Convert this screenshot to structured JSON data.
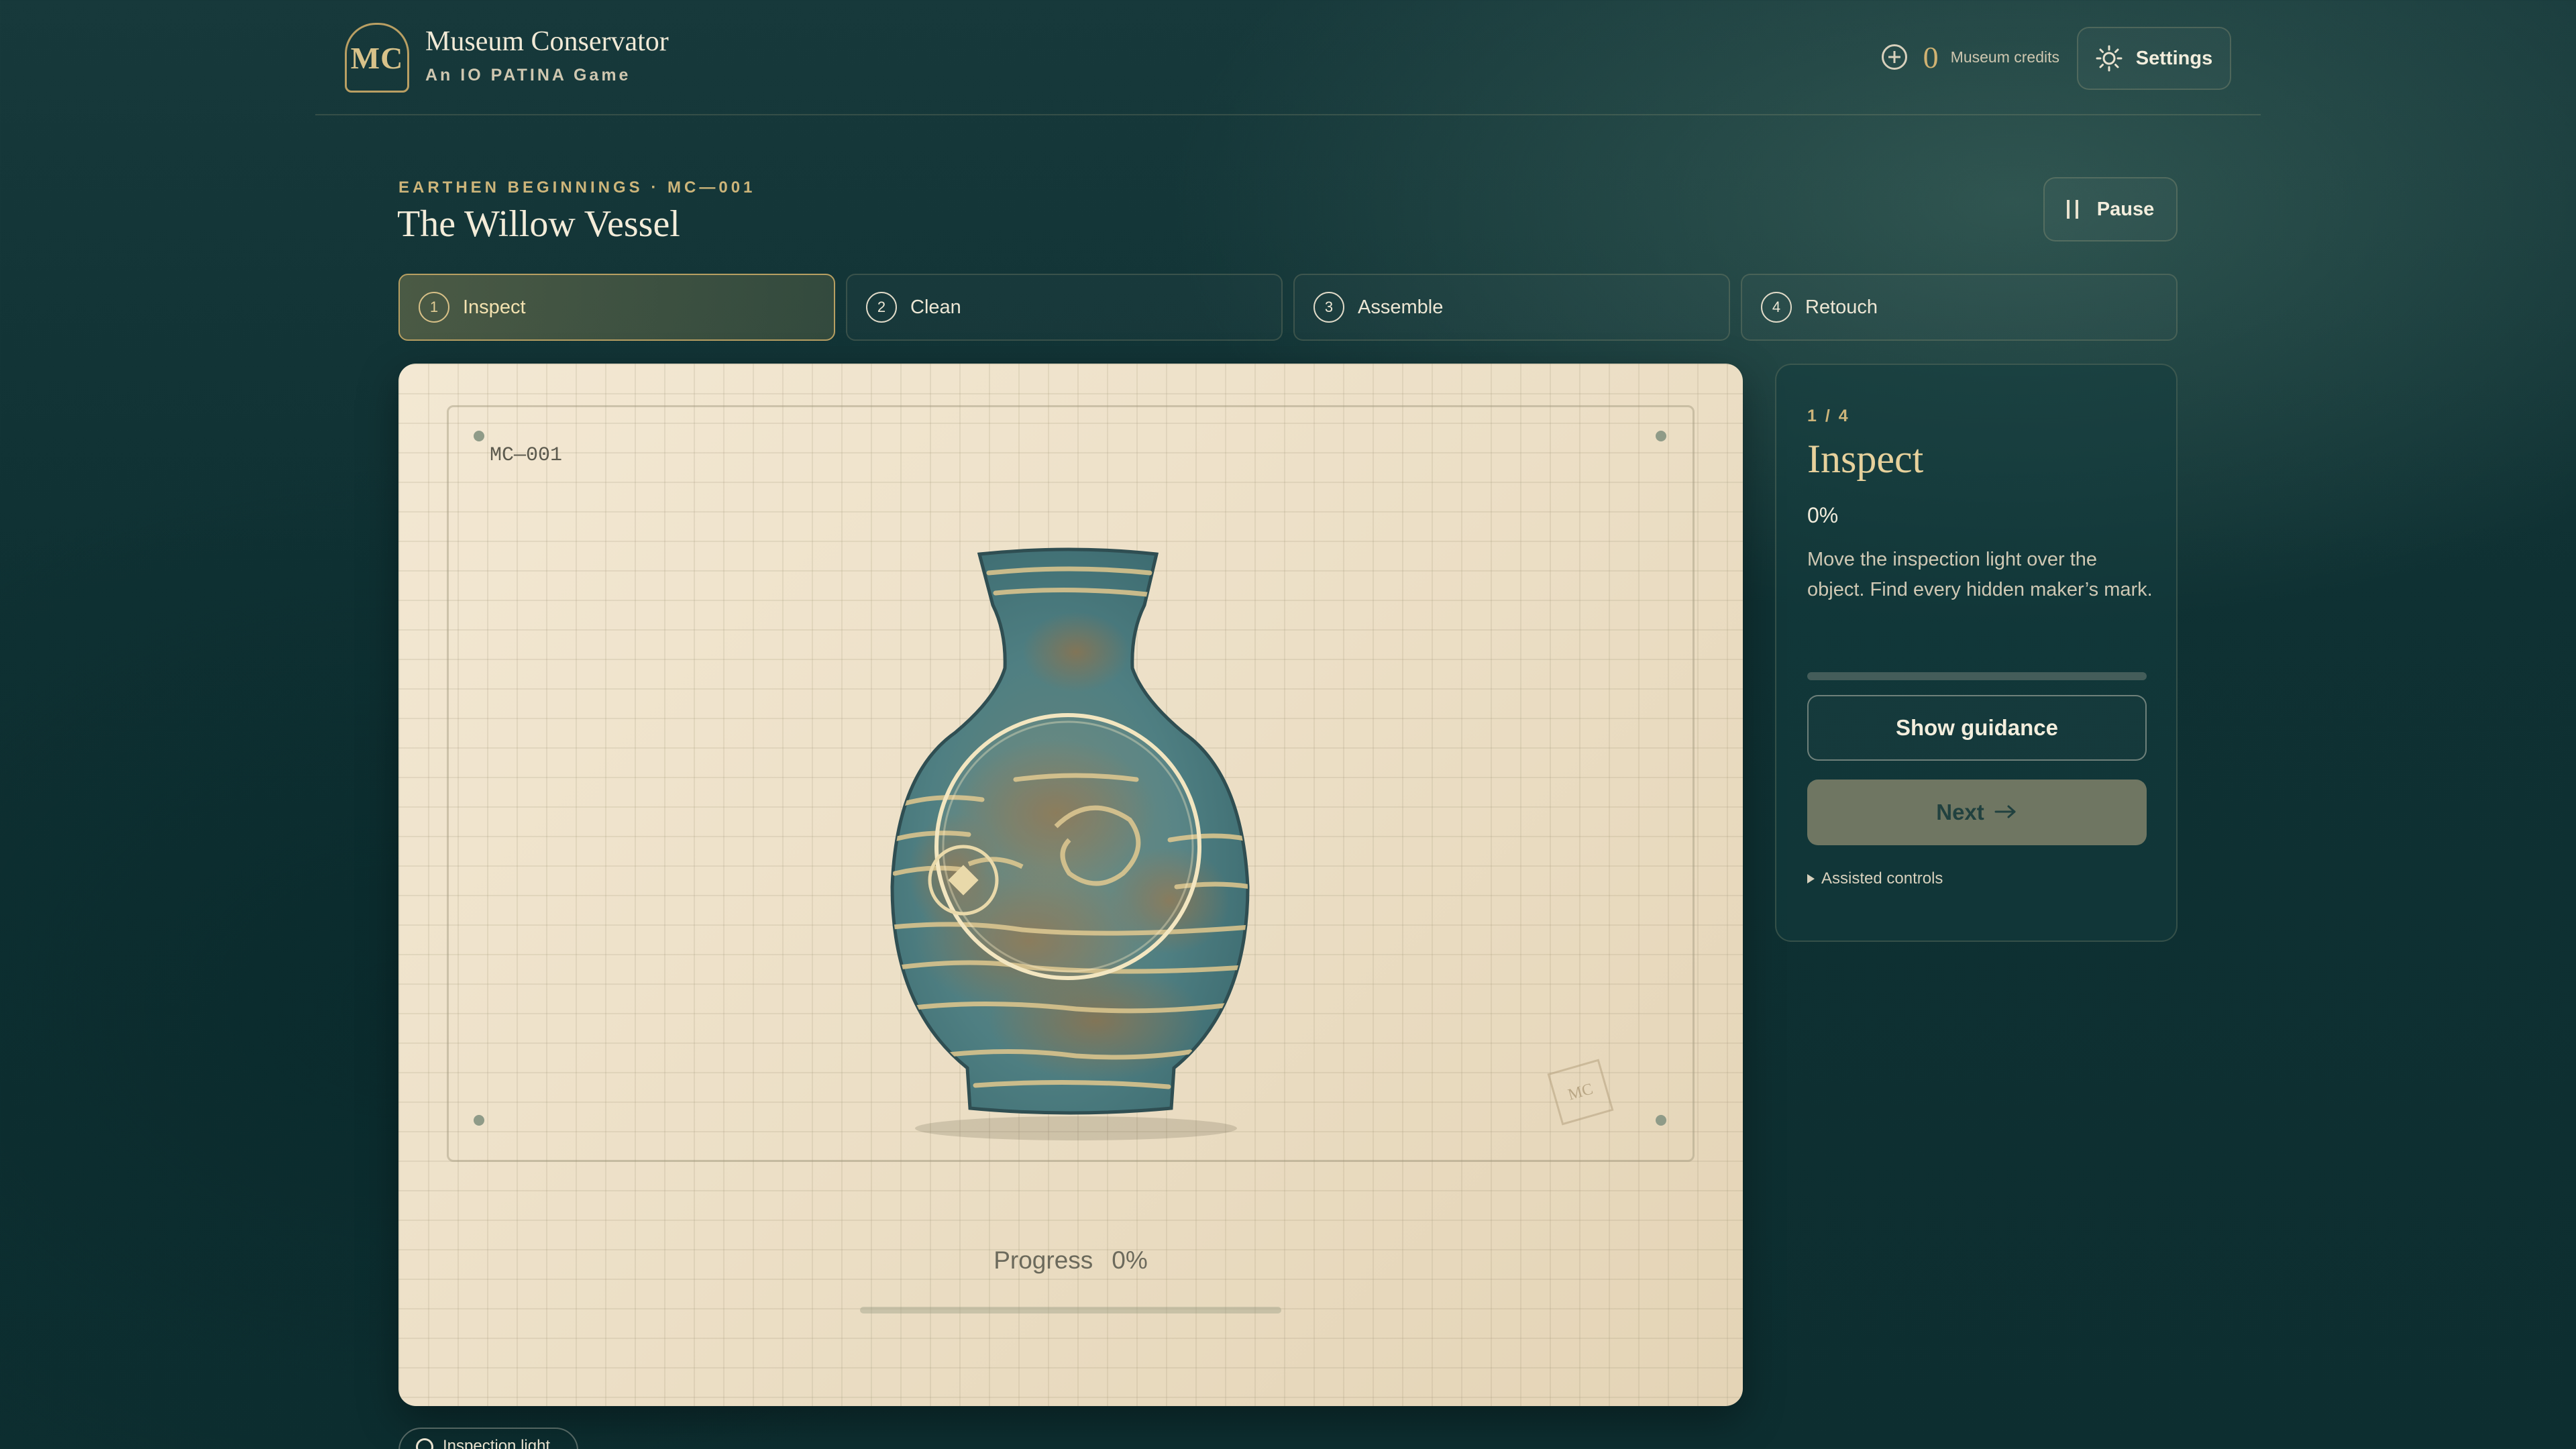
{
  "header": {
    "logo_text": "MC",
    "title": "Museum Conservator",
    "subtitle": "An IO PATINA Game",
    "credits_count": "0",
    "credits_label": "Museum credits",
    "settings_label": "Settings"
  },
  "level": {
    "eyebrow": "EARTHEN BEGINNINGS · MC—001",
    "title": "The Willow Vessel",
    "pause_label": "Pause"
  },
  "steps": [
    {
      "num": "1",
      "label": "Inspect"
    },
    {
      "num": "2",
      "label": "Clean"
    },
    {
      "num": "3",
      "label": "Assemble"
    },
    {
      "num": "4",
      "label": "Retouch"
    }
  ],
  "canvas": {
    "catalog_code": "MC—001",
    "stamp_text": "MC",
    "progress_label": "Progress",
    "progress_value": "0%",
    "progress_fraction": 0
  },
  "panel": {
    "step_count": "1 / 4",
    "title": "Inspect",
    "percent": "0%",
    "percent_fraction": 0,
    "description": "Move the inspection light over the object. Find every hidden maker’s mark.",
    "guidance_label": "Show guidance",
    "next_label": "Next",
    "assisted_label": "Assisted controls"
  },
  "tools": {
    "inspection_light_label": "Inspection light"
  },
  "colors": {
    "accent_gold": "#cdb57a",
    "background_teal": "#0f3133",
    "active_step": "#b79f62",
    "vase_teal": "#4f7f82"
  }
}
